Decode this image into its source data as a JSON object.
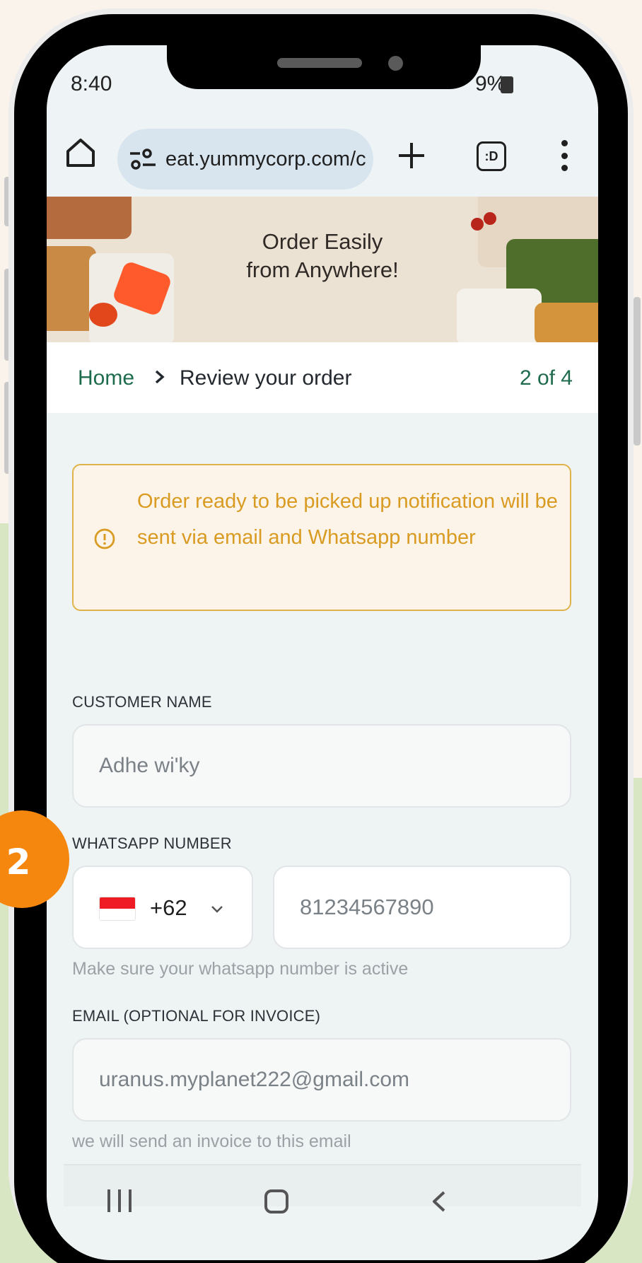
{
  "status_bar": {
    "time": "8:40",
    "battery": "9%"
  },
  "browser": {
    "url": "eat.yummycorp.com/c",
    "tab_icon_label": ":D",
    "icons": [
      "home-icon",
      "site-settings-icon",
      "new-tab-icon",
      "tab-switcher-icon",
      "menu-icon"
    ]
  },
  "banner": {
    "title_line1": "Order Easily",
    "title_line2": "from Anywhere!"
  },
  "breadcrumb": {
    "home": "Home",
    "current": "Review your order",
    "step": "2 of 4"
  },
  "notice": {
    "text": "Order ready to be picked up notification will be sent via email and Whatsapp number",
    "color": "#d99b22"
  },
  "form": {
    "customer_name_label": "CUSTOMER NAME",
    "customer_name_value": "Adhe wi'ky",
    "whatsapp_label": "WHATSAPP NUMBER",
    "country_code": "+62",
    "whatsapp_value": "81234567890",
    "whatsapp_helper": "Make sure your whatsapp number is active",
    "email_label": "EMAIL (OPTIONAL FOR INVOICE)",
    "email_value": "uranus.myplanet222@gmail.com",
    "email_helper": "we will send an invoice to this email"
  },
  "annotation": {
    "step_number": "2",
    "color": "#f5870f"
  },
  "colors": {
    "brand_green": "#1f6b4d",
    "notice_border": "#e0b34a"
  }
}
